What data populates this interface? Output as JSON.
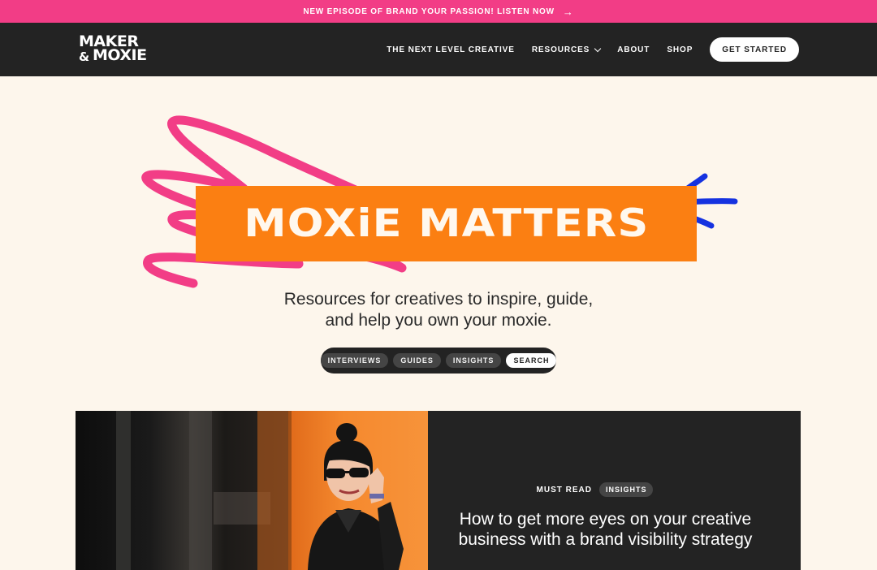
{
  "announcement": {
    "text": "NEW EPISODE OF BRAND YOUR PASSION! LISTEN NOW",
    "arrow": "→",
    "color": "#f23d86"
  },
  "header": {
    "logo": {
      "line1": "MAKER",
      "amp": "&",
      "line2": "MOXIE"
    },
    "nav": [
      {
        "label": "THE NEXT LEVEL CREATIVE"
      },
      {
        "label": "RESOURCES",
        "icon": "chevron-down-icon"
      },
      {
        "label": "ABOUT"
      },
      {
        "label": "SHOP"
      }
    ],
    "cta": "GET STARTED",
    "background": "#232323"
  },
  "hero": {
    "title": "MOXiE MATTERS",
    "title_bg": "#fb7f12",
    "scribble_color": "#f23d86",
    "accent_color": "#1532e0",
    "subtitle_line1": "Resources for creatives to inspire, guide,",
    "subtitle_line2": "and help you own your moxie.",
    "filters": [
      {
        "label": "INTERVIEWS",
        "active": false
      },
      {
        "label": "GUIDES",
        "active": false
      },
      {
        "label": "INSIGHTS",
        "active": false
      },
      {
        "label": "SEARCH",
        "active": true
      }
    ]
  },
  "featured": {
    "label": "MUST READ",
    "tag": "INSIGHTS",
    "headline_line1": "How to get more eyes on your creative",
    "headline_line2": "business with a brand visibility strategy"
  }
}
